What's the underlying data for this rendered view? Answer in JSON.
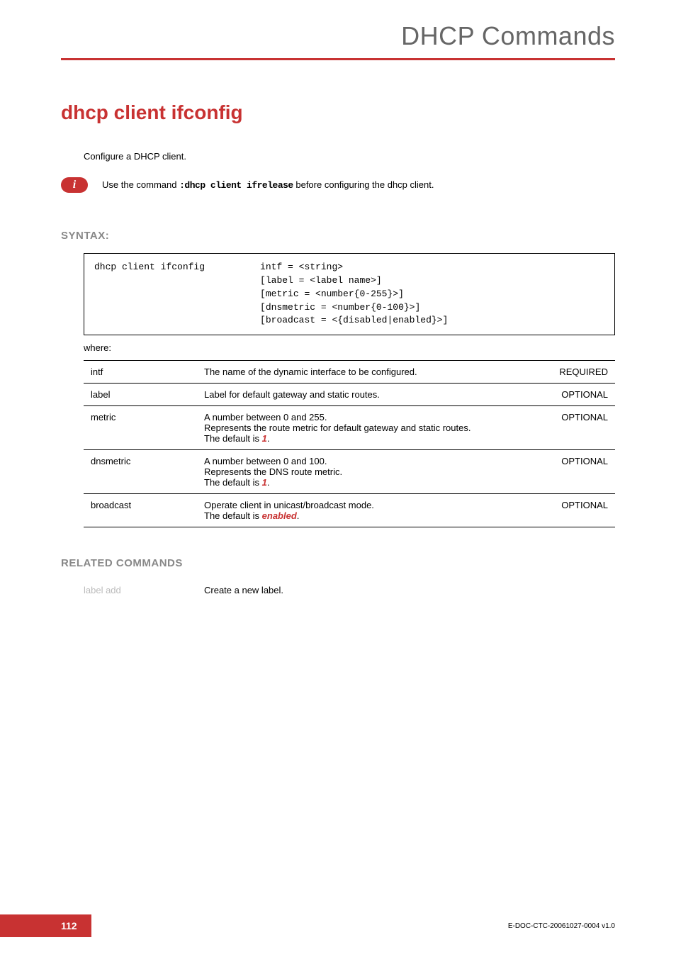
{
  "header": {
    "title": "DHCP Commands"
  },
  "main_title": "dhcp client ifconfig",
  "description": "Configure a DHCP client.",
  "info": {
    "prefix": "Use the command ",
    "command": ":dhcp client ifrelease",
    "suffix": " before configuring the dhcp client."
  },
  "syntax": {
    "heading": "SYNTAX:",
    "content": "dhcp client ifconfig          intf = <string>\n                              [label = <label name>]\n                              [metric = <number{0-255}>]\n                              [dnsmetric = <number{0-100}>]\n                              [broadcast = <{disabled|enabled}>]",
    "where": "where:",
    "params": [
      {
        "name": "intf",
        "desc": "The name of the dynamic interface to be configured.",
        "req": "REQUIRED"
      },
      {
        "name": "label",
        "desc": "Label for default gateway and static routes.",
        "req": "OPTIONAL"
      },
      {
        "name": "metric",
        "desc_line1": "A number between 0 and 255.",
        "desc_line2": "Represents the route metric for default gateway and static routes.",
        "desc_line3": "The default is ",
        "default": "1",
        "req": "OPTIONAL"
      },
      {
        "name": "dnsmetric",
        "desc_line1": "A number between 0 and 100.",
        "desc_line2": "Represents the DNS route metric.",
        "desc_line3": "The default is ",
        "default": "1",
        "req": "OPTIONAL"
      },
      {
        "name": "broadcast",
        "desc_line1": "Operate client in unicast/broadcast mode.",
        "desc_line3": "The default is ",
        "default": "enabled",
        "req": "OPTIONAL"
      }
    ]
  },
  "related": {
    "heading": "RELATED COMMANDS",
    "items": [
      {
        "cmd": "label add",
        "desc": "Create a new label."
      }
    ]
  },
  "footer": {
    "page": "112",
    "doc_id": "E-DOC-CTC-20061027-0004 v1.0"
  }
}
